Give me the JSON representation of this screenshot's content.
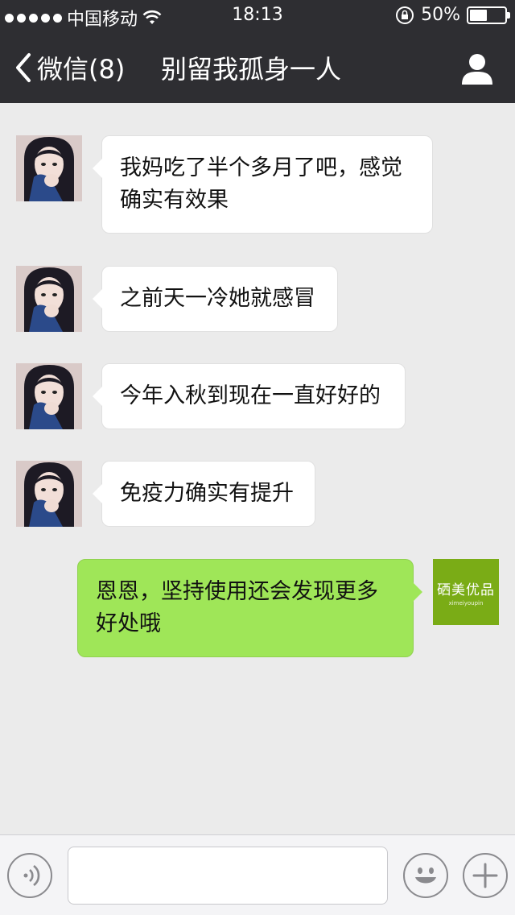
{
  "status_bar": {
    "carrier": "中国移动",
    "time": "18:13",
    "battery_text": "50%",
    "battery_level": 0.5,
    "signal_dots": 5,
    "wifi_icon": "wifi-icon",
    "lock_icon": "orientation-lock-icon"
  },
  "nav": {
    "back_label": "微信(8)",
    "title": "别留我孤身一人",
    "profile_icon": "profile-icon"
  },
  "messages": [
    {
      "sender": "other",
      "text_lines": [
        "我妈吃了半个多月了吧，感觉",
        "确实有效果"
      ]
    },
    {
      "sender": "other",
      "text_lines": [
        "之前天一冷她就感冒"
      ]
    },
    {
      "sender": "other",
      "text_lines": [
        "今年入秋到现在一直好好的"
      ]
    },
    {
      "sender": "other",
      "text_lines": [
        "免疫力确实有提升"
      ]
    },
    {
      "sender": "me",
      "text_lines": [
        "恩恩，坚持使用还会发现更多",
        "好处哦"
      ]
    }
  ],
  "my_avatar": {
    "brand_text": "硒美优品",
    "sub_text": "ximeiyoupin"
  },
  "input_bar": {
    "voice_icon": "voice-icon",
    "input_value": "",
    "emoji_icon": "emoji-icon",
    "plus_icon": "plus-icon"
  },
  "colors": {
    "nav_background": "#2e2e32",
    "chat_background": "#ebebeb",
    "my_bubble": "#9fe658",
    "other_bubble": "#ffffff",
    "brand_green": "#7aac16"
  }
}
